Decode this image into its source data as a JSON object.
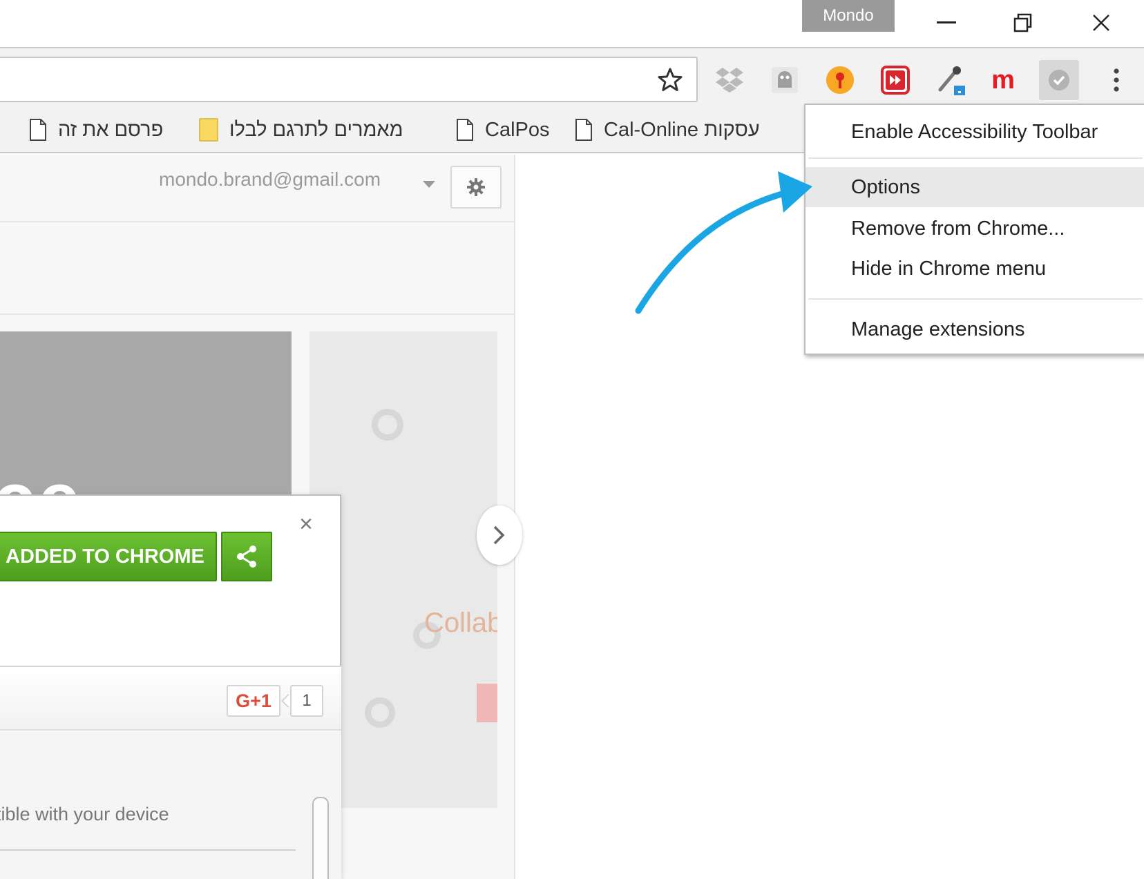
{
  "titlebar": {
    "profile_name": "Mondo"
  },
  "toolbar": {
    "star_icon": "bookmark-star-icon",
    "extensions": [
      "dropbox",
      "ghost",
      "orange-pin",
      "red-skip",
      "eyedropper",
      "m",
      "check"
    ],
    "ext_m_label": "m"
  },
  "bookmarks": [
    {
      "label": "פרסם את זה",
      "icon": "page-icon"
    },
    {
      "label": "מאמרים לתרגם לבלו",
      "icon": "folder-icon"
    },
    {
      "label": "CalPos",
      "icon": "page-icon"
    },
    {
      "label": "Cal-Online עסקות",
      "icon": "page-icon"
    }
  ],
  "account": {
    "email": "mondo.brand@gmail.com"
  },
  "promo": {
    "dark_text": "ce",
    "light_text": "Collab"
  },
  "dialog": {
    "added_label": "ADDED TO CHROME",
    "close_label": "×",
    "gplus_label": "G+1",
    "gplus_count": "1",
    "compat_text": "tible with your device"
  },
  "context_menu": {
    "items": [
      {
        "label": "Enable Accessibility Toolbar"
      },
      {
        "label": "Options"
      },
      {
        "label": "Remove from Chrome..."
      },
      {
        "label": "Hide in Chrome menu"
      },
      {
        "label": "Manage extensions"
      }
    ],
    "highlighted": "Options"
  },
  "colors": {
    "accent_green": "#5cb025",
    "arrow_blue": "#1aa6e4",
    "menu_highlight": "#e8e8e8"
  }
}
